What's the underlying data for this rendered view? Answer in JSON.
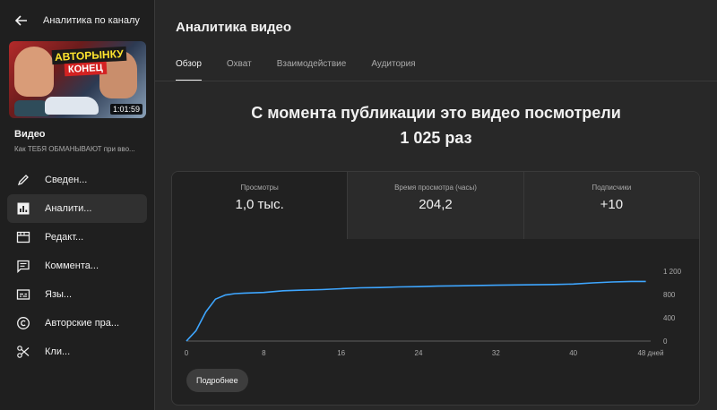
{
  "sidebar": {
    "header_title": "Аналитика по каналу",
    "thumbnail": {
      "title_line1": "АВТОРЫНКУ",
      "title_line2": "КОНЕЦ",
      "duration": "1:01:59"
    },
    "video_label": "Видео",
    "video_name": "Как ТЕБЯ ОБМАНЫВАЮТ при вво...",
    "items": [
      {
        "label": "Сведен...",
        "icon": "pencil-icon"
      },
      {
        "label": "Аналити...",
        "icon": "analytics-icon",
        "active": true
      },
      {
        "label": "Редакт...",
        "icon": "editor-icon"
      },
      {
        "label": "Коммента...",
        "icon": "comment-icon"
      },
      {
        "label": "Язы...",
        "icon": "subtitles-icon"
      },
      {
        "label": "Авторские пра...",
        "icon": "copyright-icon"
      },
      {
        "label": "Кли...",
        "icon": "scissors-icon"
      }
    ]
  },
  "main": {
    "title": "Аналитика видео",
    "tabs": [
      "Обзор",
      "Охват",
      "Взаимодействие",
      "Аудитория"
    ],
    "active_tab": "Обзор",
    "headline_line1": "С момента публикации это видео посмотрели",
    "headline_line2": "1 025 раз",
    "metrics": [
      {
        "label": "Просмотры",
        "value": "1,0 тыс."
      },
      {
        "label": "Время просмотра (часы)",
        "value": "204,2"
      },
      {
        "label": "Подписчики",
        "value": "+10"
      }
    ],
    "more_button": "Подробнее"
  },
  "colors": {
    "line": "#3ea6ff",
    "background": "#282828",
    "card": "#212121"
  },
  "chart_data": {
    "type": "line",
    "x_tick_labels": [
      "0",
      "8",
      "16",
      "24",
      "32",
      "40",
      "48 дней"
    ],
    "y_tick_labels": [
      "0",
      "400",
      "800",
      "1 200"
    ],
    "xlim": [
      0,
      48
    ],
    "ylim": [
      0,
      1200
    ],
    "x": [
      0,
      1,
      2,
      3,
      4,
      5,
      6,
      8,
      10,
      12,
      14,
      16,
      18,
      20,
      22,
      24,
      26,
      28,
      30,
      32,
      34,
      36,
      38,
      40,
      42,
      44,
      46,
      47.5
    ],
    "y": [
      0,
      180,
      500,
      720,
      790,
      815,
      825,
      835,
      865,
      875,
      885,
      900,
      915,
      920,
      930,
      935,
      945,
      950,
      955,
      960,
      965,
      968,
      972,
      980,
      1000,
      1015,
      1025,
      1025
    ],
    "grid": false
  }
}
